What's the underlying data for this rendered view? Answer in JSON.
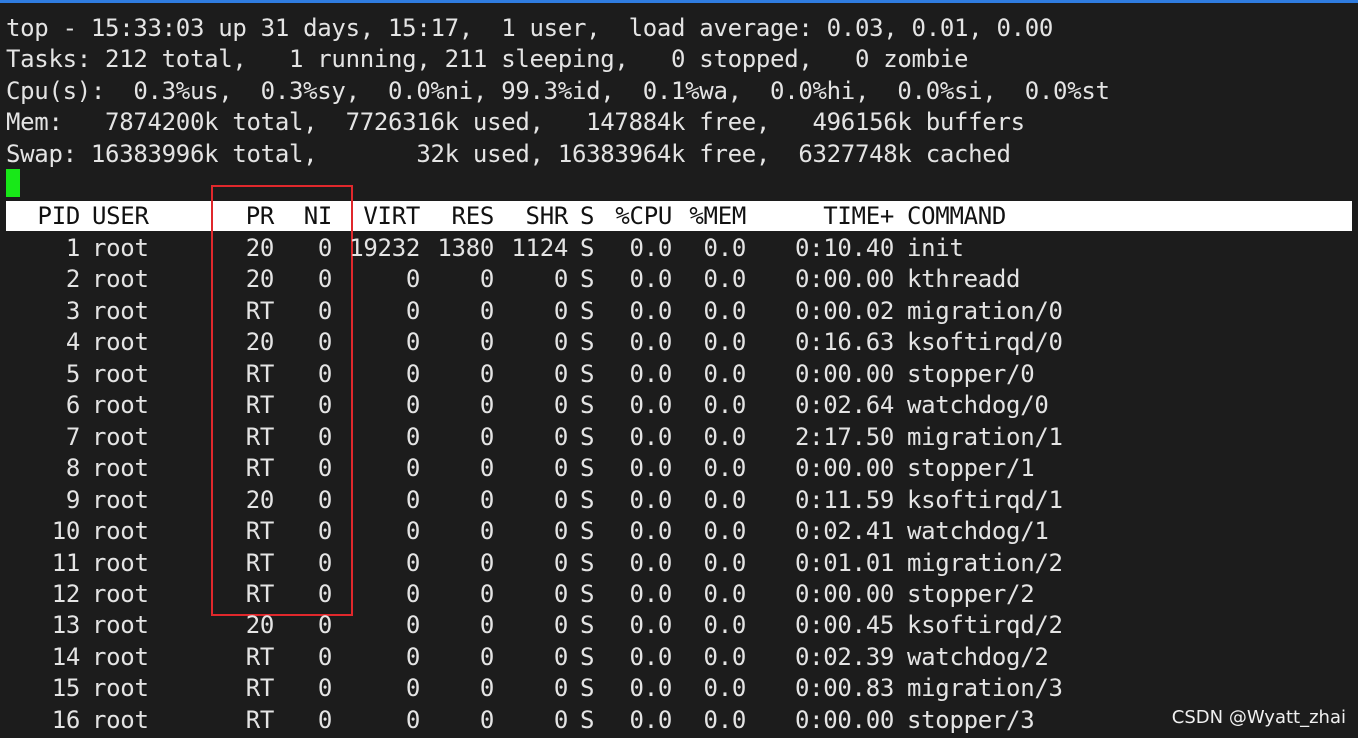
{
  "summary": {
    "line1": "top - 15:33:03 up 31 days, 15:17,  1 user,  load average: 0.03, 0.01, 0.00",
    "line2": "Tasks: 212 total,   1 running, 211 sleeping,   0 stopped,   0 zombie",
    "line3": "Cpu(s):  0.3%us,  0.3%sy,  0.0%ni, 99.3%id,  0.1%wa,  0.0%hi,  0.0%si,  0.0%st",
    "line4": "Mem:   7874200k total,  7726316k used,   147884k free,   496156k buffers",
    "line5": "Swap: 16383996k total,       32k used, 16383964k free,  6327748k cached"
  },
  "columns": [
    "PID",
    "USER",
    "PR",
    "NI",
    "VIRT",
    "RES",
    "SHR",
    "S",
    "%CPU",
    "%MEM",
    "TIME+",
    "COMMAND"
  ],
  "processes": [
    [
      "1",
      "root",
      "20",
      "0",
      "19232",
      "1380",
      "1124",
      "S",
      "0.0",
      "0.0",
      "0:10.40",
      "init"
    ],
    [
      "2",
      "root",
      "20",
      "0",
      "0",
      "0",
      "0",
      "S",
      "0.0",
      "0.0",
      "0:00.00",
      "kthreadd"
    ],
    [
      "3",
      "root",
      "RT",
      "0",
      "0",
      "0",
      "0",
      "S",
      "0.0",
      "0.0",
      "0:00.02",
      "migration/0"
    ],
    [
      "4",
      "root",
      "20",
      "0",
      "0",
      "0",
      "0",
      "S",
      "0.0",
      "0.0",
      "0:16.63",
      "ksoftirqd/0"
    ],
    [
      "5",
      "root",
      "RT",
      "0",
      "0",
      "0",
      "0",
      "S",
      "0.0",
      "0.0",
      "0:00.00",
      "stopper/0"
    ],
    [
      "6",
      "root",
      "RT",
      "0",
      "0",
      "0",
      "0",
      "S",
      "0.0",
      "0.0",
      "0:02.64",
      "watchdog/0"
    ],
    [
      "7",
      "root",
      "RT",
      "0",
      "0",
      "0",
      "0",
      "S",
      "0.0",
      "0.0",
      "2:17.50",
      "migration/1"
    ],
    [
      "8",
      "root",
      "RT",
      "0",
      "0",
      "0",
      "0",
      "S",
      "0.0",
      "0.0",
      "0:00.00",
      "stopper/1"
    ],
    [
      "9",
      "root",
      "20",
      "0",
      "0",
      "0",
      "0",
      "S",
      "0.0",
      "0.0",
      "0:11.59",
      "ksoftirqd/1"
    ],
    [
      "10",
      "root",
      "RT",
      "0",
      "0",
      "0",
      "0",
      "S",
      "0.0",
      "0.0",
      "0:02.41",
      "watchdog/1"
    ],
    [
      "11",
      "root",
      "RT",
      "0",
      "0",
      "0",
      "0",
      "S",
      "0.0",
      "0.0",
      "0:01.01",
      "migration/2"
    ],
    [
      "12",
      "root",
      "RT",
      "0",
      "0",
      "0",
      "0",
      "S",
      "0.0",
      "0.0",
      "0:00.00",
      "stopper/2"
    ],
    [
      "13",
      "root",
      "20",
      "0",
      "0",
      "0",
      "0",
      "S",
      "0.0",
      "0.0",
      "0:00.45",
      "ksoftirqd/2"
    ],
    [
      "14",
      "root",
      "RT",
      "0",
      "0",
      "0",
      "0",
      "S",
      "0.0",
      "0.0",
      "0:02.39",
      "watchdog/2"
    ],
    [
      "15",
      "root",
      "RT",
      "0",
      "0",
      "0",
      "0",
      "S",
      "0.0",
      "0.0",
      "0:00.83",
      "migration/3"
    ],
    [
      "16",
      "root",
      "RT",
      "0",
      "0",
      "0",
      "0",
      "S",
      "0.0",
      "0.0",
      "0:00.00",
      "stopper/3"
    ]
  ],
  "watermark": "CSDN @Wyatt_zhai",
  "colors": {
    "background": "#1c1c1c",
    "text": "#e4e4e4",
    "header_bar": "#ffffff",
    "cursor": "#18e818",
    "highlight_box": "#e0282c",
    "accent": "#2f7ce0"
  }
}
